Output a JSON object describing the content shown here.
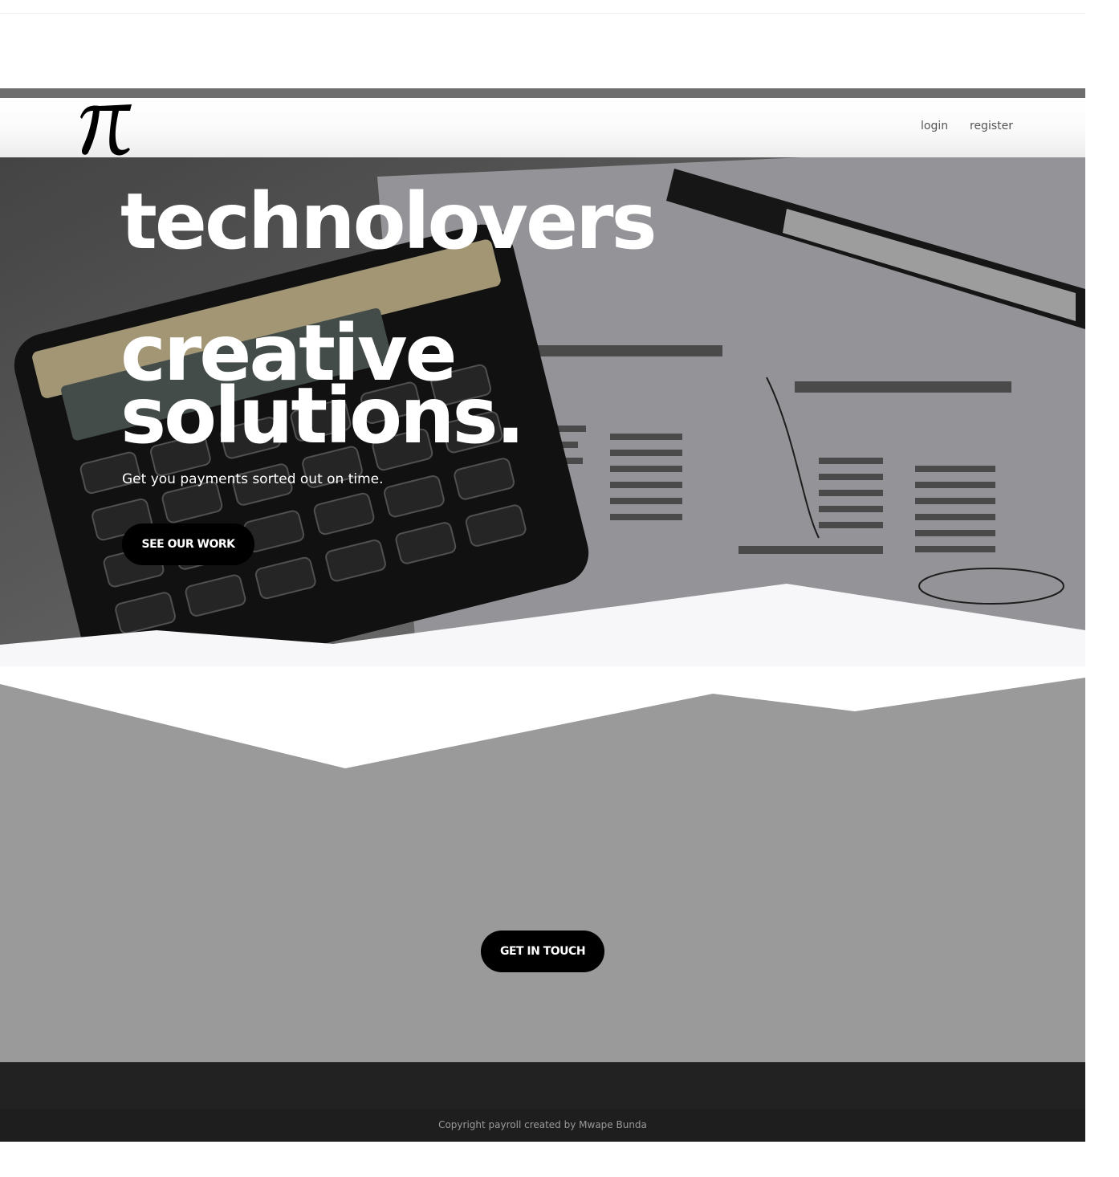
{
  "nav": {
    "logo_symbol": "π",
    "login_label": "login",
    "register_label": "register"
  },
  "hero": {
    "line1": "technolovers",
    "line2": "creative",
    "line3": "solutions.",
    "tagline": "Get you payments sorted out on time.",
    "cta_label": "SEE OUR WORK",
    "background_icon": "calculator-and-paperwork-photo"
  },
  "contact": {
    "cta_label": "GET IN TOUCH"
  },
  "footer": {
    "copyright": "Copyright payroll created by Mwape Bunda"
  },
  "colors": {
    "button_bg": "#000000",
    "cta_section_bg": "#9a9a9a",
    "footer_bg": "#222222"
  }
}
